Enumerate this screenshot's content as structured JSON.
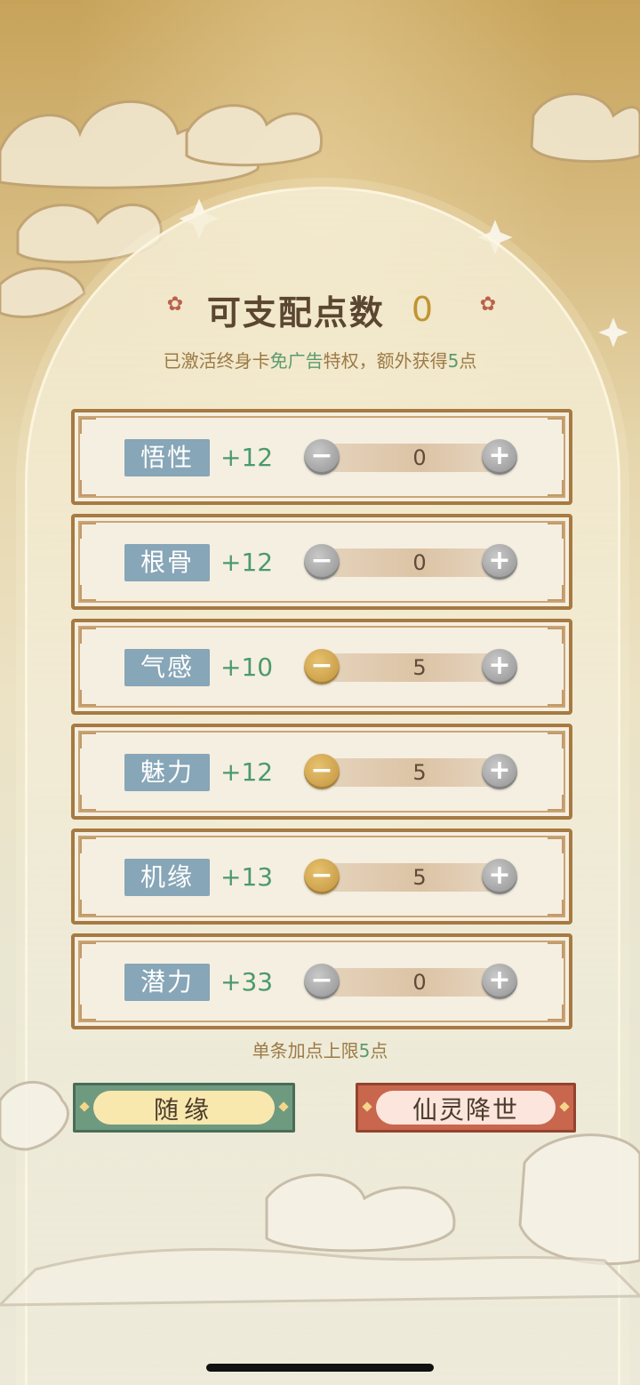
{
  "header": {
    "title": "可支配点数",
    "points": "0",
    "subtitle_parts": [
      "已激活终身卡",
      "免广告",
      "特权，额外获得",
      "5",
      "点"
    ]
  },
  "stats": [
    {
      "label": "悟性",
      "base": "+12",
      "value": "0",
      "minus_enabled": false
    },
    {
      "label": "根骨",
      "base": "+12",
      "value": "0",
      "minus_enabled": false
    },
    {
      "label": "气感",
      "base": "+10",
      "value": "5",
      "minus_enabled": true
    },
    {
      "label": "魅力",
      "base": "+12",
      "value": "5",
      "minus_enabled": true
    },
    {
      "label": "机缘",
      "base": "+13",
      "value": "5",
      "minus_enabled": true
    },
    {
      "label": "潜力",
      "base": "+33",
      "value": "0",
      "minus_enabled": false
    }
  ],
  "controls": {
    "minus_symbol": "−",
    "plus_symbol": "+"
  },
  "limit_note_parts": [
    "单条加点上限",
    "5",
    "点"
  ],
  "actions": {
    "random_label": "随缘",
    "immortal_label": "仙灵降世"
  },
  "decor": {
    "flower_glyph": "✿"
  },
  "colors": {
    "accent_gold": "#c19435",
    "accent_green": "#4c9a6c",
    "label_bg": "#87a6b7",
    "button_green": "#6e9a80",
    "button_red": "#c8664e"
  }
}
